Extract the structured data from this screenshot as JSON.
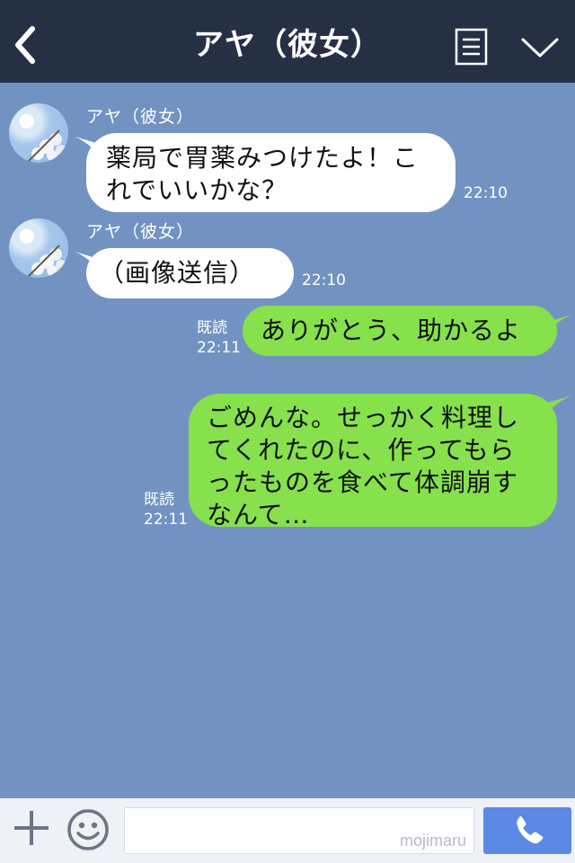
{
  "header": {
    "title": "アヤ（彼女）",
    "icons": [
      "back-icon",
      "menu-icon",
      "chevron-down-icon"
    ]
  },
  "messages": [
    {
      "direction": "in",
      "sender": "アヤ（彼女）",
      "lines": [
        "薬局で胃薬みつけたよ！こ",
        "れでいいかな？"
      ],
      "time": "22:10"
    },
    {
      "direction": "in",
      "sender": "アヤ（彼女）",
      "lines": [
        "（画像送信）"
      ],
      "time": "22:10"
    },
    {
      "direction": "out",
      "read": "既読",
      "lines": [
        "ありがとう、助かるよ"
      ],
      "time": "22:11"
    },
    {
      "direction": "out",
      "read": "既読",
      "lines": [
        "ごめんな。せっかく料理し",
        "てくれたのに、作ってもら",
        "ったものを食べて体調崩す",
        "なんて…"
      ],
      "time": "22:11"
    }
  ],
  "footer": {
    "watermark": "mojimaru",
    "icons": [
      "plus-icon",
      "smiley-icon",
      "phone-icon"
    ]
  },
  "colors": {
    "background": "#7293c2",
    "header": "#263045",
    "incoming_bubble": "#ffffff",
    "outgoing_bubble": "#86e14c",
    "call_button": "#5b89e3"
  }
}
